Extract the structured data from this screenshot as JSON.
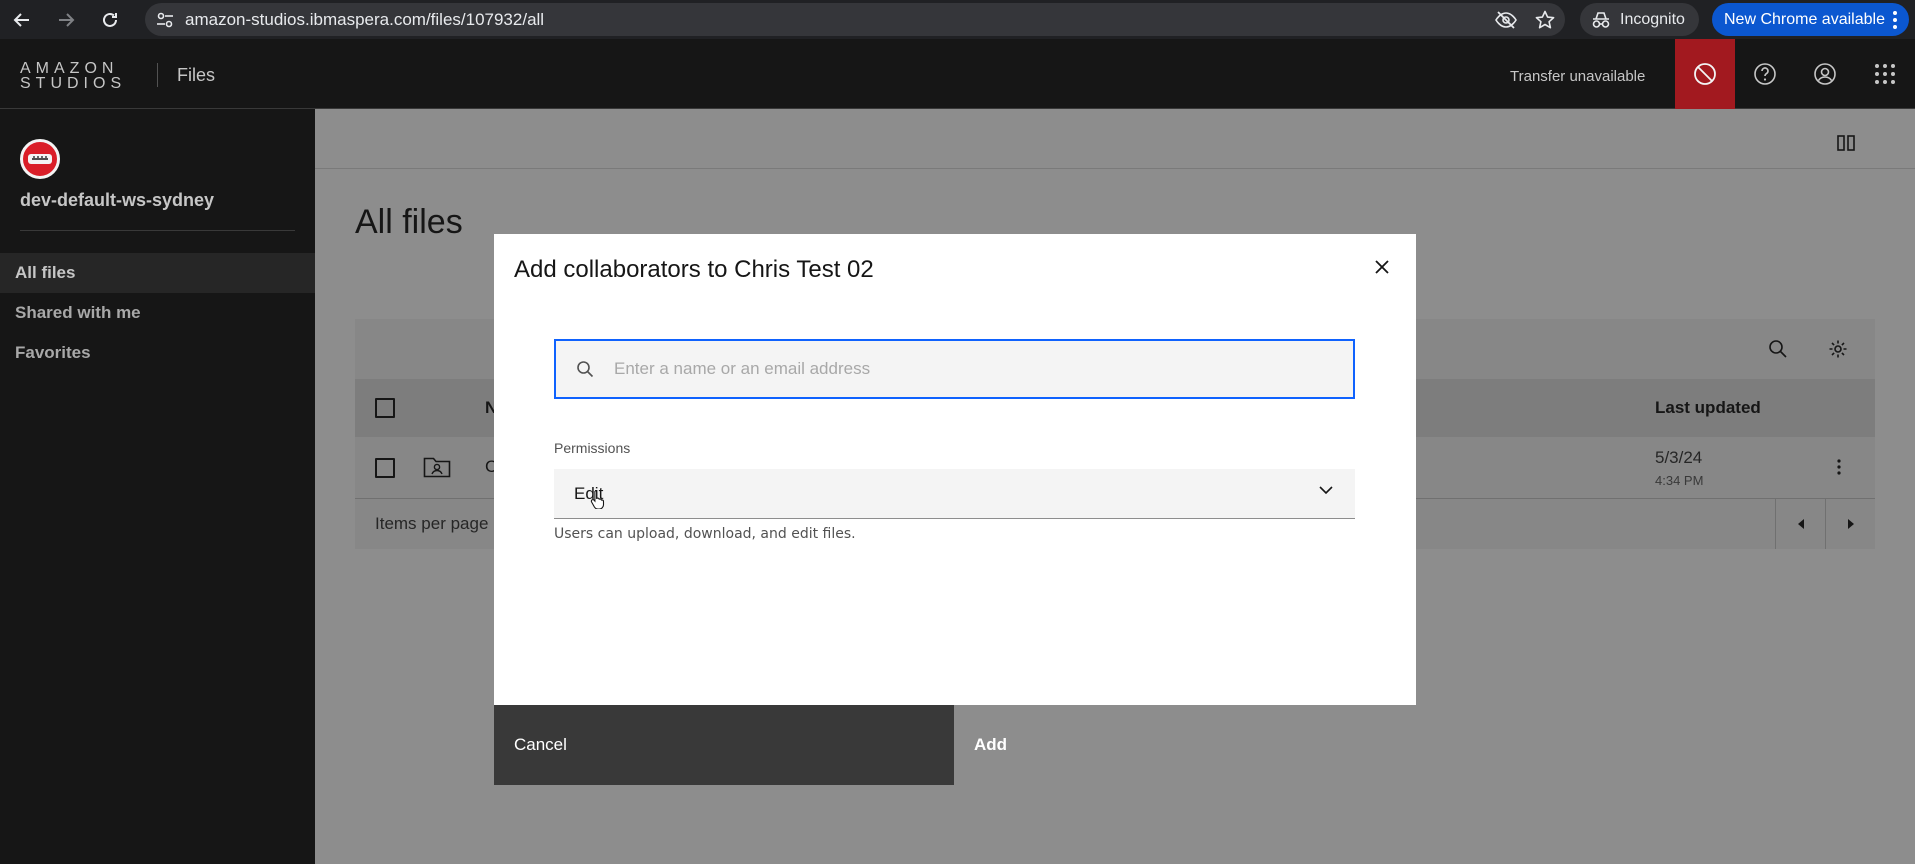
{
  "browser": {
    "url": "amazon-studios.ibmaspera.com/files/107932/all",
    "incognito_label": "Incognito",
    "update_label": "New Chrome available"
  },
  "header": {
    "logo_line1": "AMAZON",
    "logo_line2": "STUDIOS",
    "app_title": "Files",
    "transfer_status": "Transfer unavailable"
  },
  "sidebar": {
    "workspace_name": "dev-default-ws-sydney",
    "items": [
      {
        "label": "All files"
      },
      {
        "label": "Shared with me"
      },
      {
        "label": "Favorites"
      }
    ]
  },
  "main": {
    "page_title": "All files",
    "table": {
      "name_header_partial": "N",
      "updated_header": "Last updated",
      "rows": [
        {
          "name_partial": "C",
          "updated_date": "5/3/24",
          "updated_time": "4:34 PM"
        }
      ],
      "items_per_page_label": "Items per page"
    }
  },
  "modal": {
    "title": "Add collaborators to Chris Test 02",
    "search": {
      "placeholder": "Enter a name or an email address",
      "value": ""
    },
    "permissions": {
      "label": "Permissions",
      "selected": "Edit",
      "helper": "Users can upload, download, and edit files."
    },
    "cancel_label": "Cancel",
    "add_label": "Add"
  }
}
